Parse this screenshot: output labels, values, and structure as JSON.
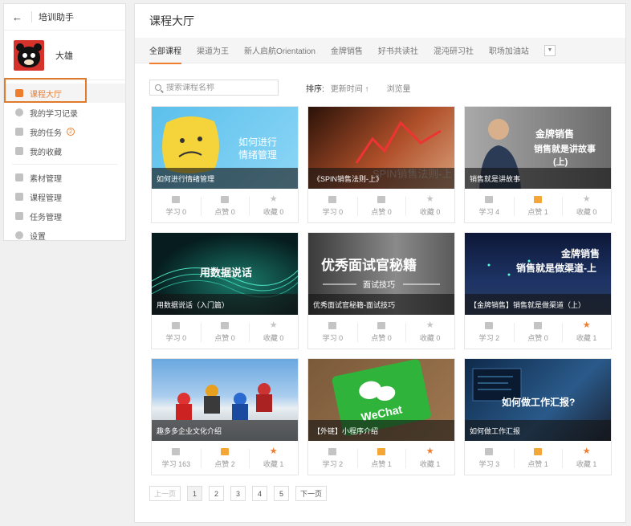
{
  "sidebar": {
    "back_icon": "arrow-left",
    "app_title": "培训助手",
    "user": {
      "name": "大雄"
    },
    "items": [
      {
        "label": "课程大厅",
        "icon": "list-icon",
        "active": true
      },
      {
        "label": "我的学习记录",
        "icon": "clock-icon"
      },
      {
        "label": "我的任务",
        "icon": "shield-icon",
        "badge": "2"
      },
      {
        "label": "我的收藏",
        "icon": "folder-icon"
      },
      {
        "label": "素材管理",
        "icon": "material-icon"
      },
      {
        "label": "课程管理",
        "icon": "copy-icon"
      },
      {
        "label": "任务管理",
        "icon": "task-icon"
      },
      {
        "label": "设置",
        "icon": "gear-icon"
      }
    ]
  },
  "main": {
    "title": "课程大厅",
    "tabs": [
      "全部课程",
      "渠道为王",
      "新人启航Orientation",
      "金牌销售",
      "好书共读社",
      "混沌研习社",
      "职场加油站"
    ],
    "search": {
      "placeholder": "搜索课程名称"
    },
    "sort": {
      "label": "排序:",
      "option1": "更新时间 ↑",
      "option2": "浏览量"
    }
  },
  "courses": [
    {
      "title": "如何进行情绪管理",
      "overlay": "如何进行\n情绪管理",
      "study": "学习 0",
      "like": "点赞 0",
      "fav": "收藏 0",
      "liked": false,
      "faved": false
    },
    {
      "title": "《SPIN销售法则-上》",
      "overlay": "SPIN销售法则-上",
      "study": "学习 0",
      "like": "点赞 0",
      "fav": "收藏 0",
      "liked": false,
      "faved": false
    },
    {
      "title": "销售就是讲故事",
      "overlay": "金牌销售\n销售就是讲故事\n(上)",
      "study": "学习 4",
      "like": "点赞 1",
      "fav": "收藏 0",
      "liked": true,
      "faved": false
    },
    {
      "title": "用数据说话（入门篇）",
      "overlay": "用数据说话",
      "study": "学习 0",
      "like": "点赞 0",
      "fav": "收藏 0",
      "liked": false,
      "faved": false
    },
    {
      "title": "优秀面试官秘籍-面试技巧",
      "overlay": "优秀面试官秘籍\n—— 面试技巧 ——",
      "study": "学习 0",
      "like": "点赞 0",
      "fav": "收藏 0",
      "liked": false,
      "faved": false
    },
    {
      "title": "【金牌销售】销售就是做渠道（上）",
      "overlay": "金牌销售\n销售就是做渠道-上",
      "study": "学习 2",
      "like": "点赞 0",
      "fav": "收藏 1",
      "liked": false,
      "faved": true
    },
    {
      "title": "趣多多企业文化介绍",
      "overlay": "",
      "study": "学习 163",
      "like": "点赞 2",
      "fav": "收藏 1",
      "liked": true,
      "faved": true
    },
    {
      "title": "【外链】小程序介绍",
      "overlay": "WeChat",
      "study": "学习 2",
      "like": "点赞 1",
      "fav": "收藏 1",
      "liked": true,
      "faved": true
    },
    {
      "title": "如何做工作汇报",
      "overlay": "如何做工作汇报?",
      "study": "学习 3",
      "like": "点赞 1",
      "fav": "收藏 1",
      "liked": true,
      "faved": true
    }
  ],
  "pagination": {
    "prev": "上一页",
    "pages": [
      "1",
      "2",
      "3",
      "4",
      "5"
    ],
    "next": "下一页",
    "current": "1"
  },
  "colors": {
    "accent": "#ee7d2e",
    "like": "#f4a636"
  }
}
